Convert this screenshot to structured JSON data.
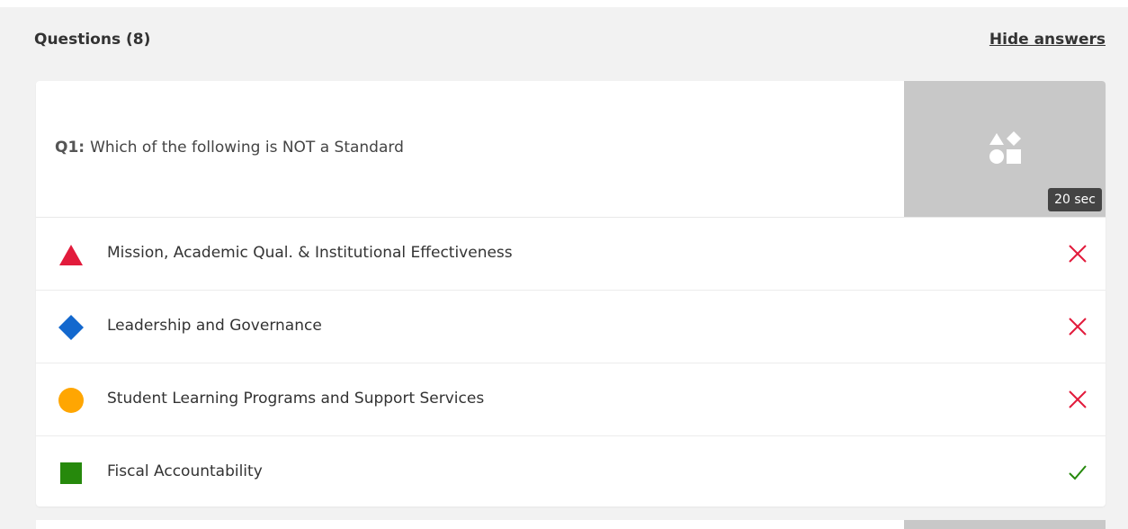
{
  "header": {
    "title": "Questions (8)",
    "toggle_label": "Hide answers"
  },
  "question": {
    "number": "Q1:",
    "text": "Which of the following is NOT a Standard",
    "time": "20 sec",
    "media_icon": "shapes-icon"
  },
  "answers": [
    {
      "label": "Mission, Academic Qual. & Institutional Effectiveness",
      "shape": "triangle",
      "color": "#e21b3c",
      "correct": false
    },
    {
      "label": "Leadership and Governance",
      "shape": "diamond",
      "color": "#1368ce",
      "correct": false
    },
    {
      "label": "Student Learning Programs and Support Services",
      "shape": "circle",
      "color": "#ffa602",
      "correct": false
    },
    {
      "label": "Fiscal Accountability",
      "shape": "square",
      "color": "#26890c",
      "correct": true
    }
  ],
  "colors": {
    "wrong": "#e21b3c",
    "correct": "#26890c",
    "media_bg": "#c8c8c8"
  }
}
